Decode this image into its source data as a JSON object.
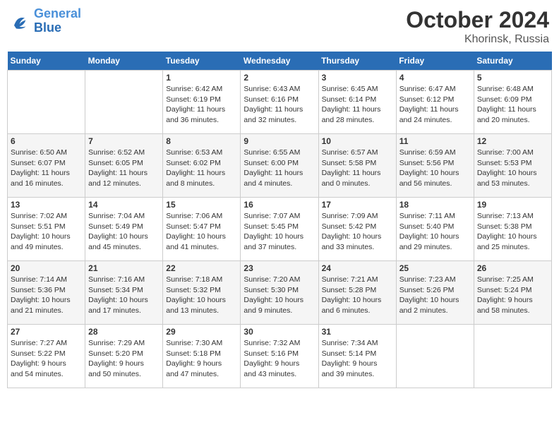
{
  "logo": {
    "text_general": "General",
    "text_blue": "Blue"
  },
  "header": {
    "month": "October 2024",
    "location": "Khorinsk, Russia"
  },
  "days_of_week": [
    "Sunday",
    "Monday",
    "Tuesday",
    "Wednesday",
    "Thursday",
    "Friday",
    "Saturday"
  ],
  "weeks": [
    [
      {
        "day": "",
        "info": ""
      },
      {
        "day": "",
        "info": ""
      },
      {
        "day": "1",
        "info": "Sunrise: 6:42 AM\nSunset: 6:19 PM\nDaylight: 11 hours\nand 36 minutes."
      },
      {
        "day": "2",
        "info": "Sunrise: 6:43 AM\nSunset: 6:16 PM\nDaylight: 11 hours\nand 32 minutes."
      },
      {
        "day": "3",
        "info": "Sunrise: 6:45 AM\nSunset: 6:14 PM\nDaylight: 11 hours\nand 28 minutes."
      },
      {
        "day": "4",
        "info": "Sunrise: 6:47 AM\nSunset: 6:12 PM\nDaylight: 11 hours\nand 24 minutes."
      },
      {
        "day": "5",
        "info": "Sunrise: 6:48 AM\nSunset: 6:09 PM\nDaylight: 11 hours\nand 20 minutes."
      }
    ],
    [
      {
        "day": "6",
        "info": "Sunrise: 6:50 AM\nSunset: 6:07 PM\nDaylight: 11 hours\nand 16 minutes."
      },
      {
        "day": "7",
        "info": "Sunrise: 6:52 AM\nSunset: 6:05 PM\nDaylight: 11 hours\nand 12 minutes."
      },
      {
        "day": "8",
        "info": "Sunrise: 6:53 AM\nSunset: 6:02 PM\nDaylight: 11 hours\nand 8 minutes."
      },
      {
        "day": "9",
        "info": "Sunrise: 6:55 AM\nSunset: 6:00 PM\nDaylight: 11 hours\nand 4 minutes."
      },
      {
        "day": "10",
        "info": "Sunrise: 6:57 AM\nSunset: 5:58 PM\nDaylight: 11 hours\nand 0 minutes."
      },
      {
        "day": "11",
        "info": "Sunrise: 6:59 AM\nSunset: 5:56 PM\nDaylight: 10 hours\nand 56 minutes."
      },
      {
        "day": "12",
        "info": "Sunrise: 7:00 AM\nSunset: 5:53 PM\nDaylight: 10 hours\nand 53 minutes."
      }
    ],
    [
      {
        "day": "13",
        "info": "Sunrise: 7:02 AM\nSunset: 5:51 PM\nDaylight: 10 hours\nand 49 minutes."
      },
      {
        "day": "14",
        "info": "Sunrise: 7:04 AM\nSunset: 5:49 PM\nDaylight: 10 hours\nand 45 minutes."
      },
      {
        "day": "15",
        "info": "Sunrise: 7:06 AM\nSunset: 5:47 PM\nDaylight: 10 hours\nand 41 minutes."
      },
      {
        "day": "16",
        "info": "Sunrise: 7:07 AM\nSunset: 5:45 PM\nDaylight: 10 hours\nand 37 minutes."
      },
      {
        "day": "17",
        "info": "Sunrise: 7:09 AM\nSunset: 5:42 PM\nDaylight: 10 hours\nand 33 minutes."
      },
      {
        "day": "18",
        "info": "Sunrise: 7:11 AM\nSunset: 5:40 PM\nDaylight: 10 hours\nand 29 minutes."
      },
      {
        "day": "19",
        "info": "Sunrise: 7:13 AM\nSunset: 5:38 PM\nDaylight: 10 hours\nand 25 minutes."
      }
    ],
    [
      {
        "day": "20",
        "info": "Sunrise: 7:14 AM\nSunset: 5:36 PM\nDaylight: 10 hours\nand 21 minutes."
      },
      {
        "day": "21",
        "info": "Sunrise: 7:16 AM\nSunset: 5:34 PM\nDaylight: 10 hours\nand 17 minutes."
      },
      {
        "day": "22",
        "info": "Sunrise: 7:18 AM\nSunset: 5:32 PM\nDaylight: 10 hours\nand 13 minutes."
      },
      {
        "day": "23",
        "info": "Sunrise: 7:20 AM\nSunset: 5:30 PM\nDaylight: 10 hours\nand 9 minutes."
      },
      {
        "day": "24",
        "info": "Sunrise: 7:21 AM\nSunset: 5:28 PM\nDaylight: 10 hours\nand 6 minutes."
      },
      {
        "day": "25",
        "info": "Sunrise: 7:23 AM\nSunset: 5:26 PM\nDaylight: 10 hours\nand 2 minutes."
      },
      {
        "day": "26",
        "info": "Sunrise: 7:25 AM\nSunset: 5:24 PM\nDaylight: 9 hours\nand 58 minutes."
      }
    ],
    [
      {
        "day": "27",
        "info": "Sunrise: 7:27 AM\nSunset: 5:22 PM\nDaylight: 9 hours\nand 54 minutes."
      },
      {
        "day": "28",
        "info": "Sunrise: 7:29 AM\nSunset: 5:20 PM\nDaylight: 9 hours\nand 50 minutes."
      },
      {
        "day": "29",
        "info": "Sunrise: 7:30 AM\nSunset: 5:18 PM\nDaylight: 9 hours\nand 47 minutes."
      },
      {
        "day": "30",
        "info": "Sunrise: 7:32 AM\nSunset: 5:16 PM\nDaylight: 9 hours\nand 43 minutes."
      },
      {
        "day": "31",
        "info": "Sunrise: 7:34 AM\nSunset: 5:14 PM\nDaylight: 9 hours\nand 39 minutes."
      },
      {
        "day": "",
        "info": ""
      },
      {
        "day": "",
        "info": ""
      }
    ]
  ]
}
